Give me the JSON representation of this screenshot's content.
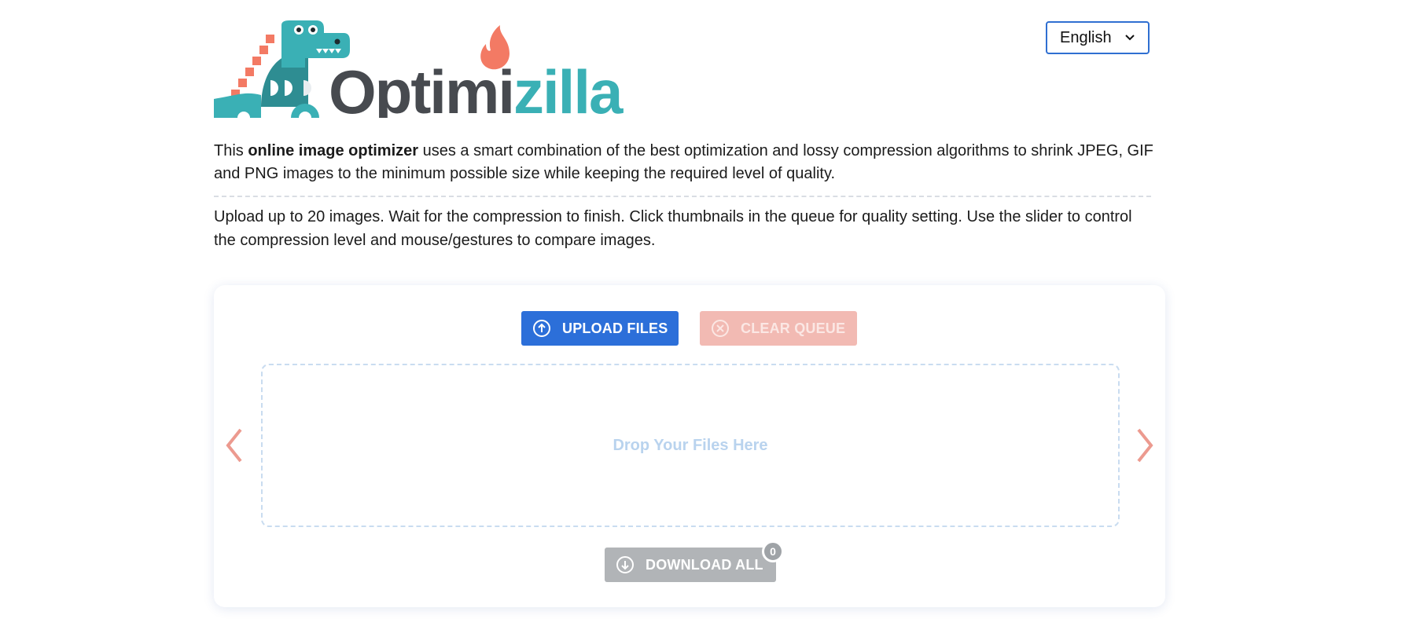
{
  "header": {
    "logo_text": "Optimizilla",
    "language": "English"
  },
  "intro": {
    "before": "This ",
    "bold": "online image optimizer",
    "after": " uses a smart combination of the best optimization and lossy compression algorithms to shrink JPEG, GIF and PNG images to the minimum possible size while keeping the required level of quality."
  },
  "help": {
    "text": "Upload up to 20 images. Wait for the compression to finish. Click thumbnails in the queue for quality setting. Use the slider to control the compression level and mouse/gestures to compare images."
  },
  "panel": {
    "upload_label": "UPLOAD FILES",
    "clear_label": "CLEAR QUEUE",
    "drop_text": "Drop Your Files Here",
    "download_label": "DOWNLOAD ALL",
    "download_count": "0"
  },
  "colors": {
    "upload_button": "#2c6fd9",
    "clear_button": "#f2bab3",
    "download_button": "#b1b4b7",
    "arrow": "#ec9a8f",
    "brand_teal": "#3ab0b5",
    "brand_gray": "#474a4f",
    "brand_coral": "#f37a64"
  },
  "icons": {
    "upload": "arrow-up-circle-icon",
    "clear": "x-circle-icon",
    "download": "arrow-down-circle-icon",
    "prev": "chevron-left-icon",
    "next": "chevron-right-icon",
    "language": "chevron-down-icon"
  }
}
